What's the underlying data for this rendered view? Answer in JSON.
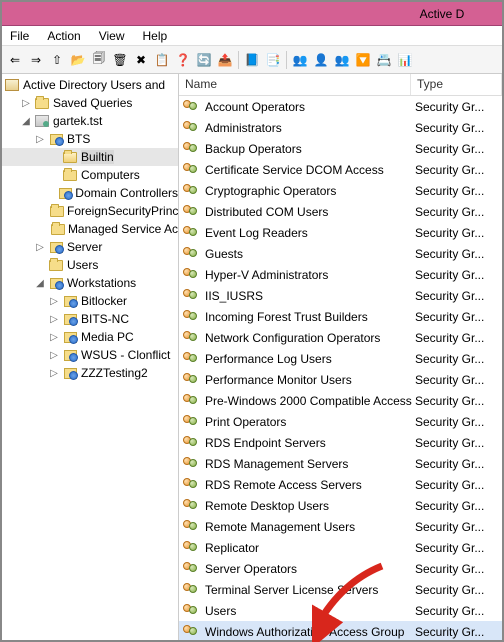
{
  "title": "Active D",
  "menu": {
    "file": "File",
    "action": "Action",
    "view": "View",
    "help": "Help"
  },
  "toolbar_icons": [
    "⇐",
    "⇒",
    "⇧",
    "📂",
    "🗐",
    "🗑",
    "✖",
    "📋",
    "❓",
    "🔄",
    "📤",
    "|",
    "📘",
    "📑",
    "|",
    "👥",
    "👤",
    "👥",
    "🔽",
    "📇",
    "📊"
  ],
  "tree": {
    "root": "Active Directory Users and",
    "items": [
      {
        "depth": 1,
        "twisty": "▷",
        "icon": "folder",
        "label": "Saved Queries"
      },
      {
        "depth": 1,
        "twisty": "◢",
        "icon": "domain",
        "label": "gartek.tst"
      },
      {
        "depth": 2,
        "twisty": "▷",
        "icon": "ou",
        "label": "BTS"
      },
      {
        "depth": 3,
        "twisty": "",
        "icon": "folder",
        "label": "Builtin",
        "selected": true
      },
      {
        "depth": 3,
        "twisty": "",
        "icon": "folder",
        "label": "Computers"
      },
      {
        "depth": 3,
        "twisty": "",
        "icon": "ou",
        "label": "Domain Controllers"
      },
      {
        "depth": 3,
        "twisty": "",
        "icon": "folder",
        "label": "ForeignSecurityPrinc"
      },
      {
        "depth": 3,
        "twisty": "",
        "icon": "folder",
        "label": "Managed Service Ac"
      },
      {
        "depth": 2,
        "twisty": "▷",
        "icon": "ou",
        "label": "Server"
      },
      {
        "depth": 2,
        "twisty": "",
        "icon": "folder",
        "label": "Users"
      },
      {
        "depth": 2,
        "twisty": "◢",
        "icon": "ou",
        "label": "Workstations"
      },
      {
        "depth": 3,
        "twisty": "▷",
        "icon": "ou",
        "label": "Bitlocker"
      },
      {
        "depth": 3,
        "twisty": "▷",
        "icon": "ou",
        "label": "BITS-NC"
      },
      {
        "depth": 3,
        "twisty": "▷",
        "icon": "ou",
        "label": "Media PC"
      },
      {
        "depth": 3,
        "twisty": "▷",
        "icon": "ou",
        "label": "WSUS - Clonflict"
      },
      {
        "depth": 3,
        "twisty": "▷",
        "icon": "ou",
        "label": "ZZZTesting2"
      }
    ]
  },
  "list": {
    "columns": {
      "name": "Name",
      "type": "Type"
    },
    "type_value": "Security Gr...",
    "rows": [
      "Account Operators",
      "Administrators",
      "Backup Operators",
      "Certificate Service DCOM Access",
      "Cryptographic Operators",
      "Distributed COM Users",
      "Event Log Readers",
      "Guests",
      "Hyper-V Administrators",
      "IIS_IUSRS",
      "Incoming Forest Trust Builders",
      "Network Configuration Operators",
      "Performance Log Users",
      "Performance Monitor Users",
      "Pre-Windows 2000 Compatible Access",
      "Print Operators",
      "RDS Endpoint Servers",
      "RDS Management Servers",
      "RDS Remote Access Servers",
      "Remote Desktop Users",
      "Remote Management Users",
      "Replicator",
      "Server Operators",
      "Terminal Server License Servers",
      "Users",
      "Windows Authorization Access Group"
    ],
    "highlight_index": 25
  }
}
